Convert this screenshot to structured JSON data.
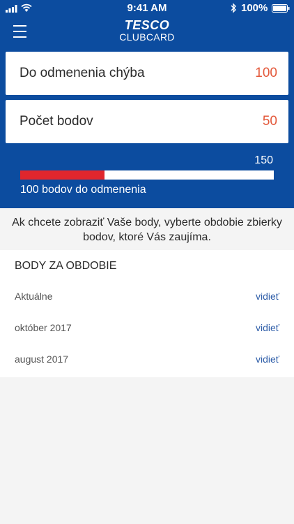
{
  "status": {
    "time": "9:41 AM",
    "battery": "100%"
  },
  "brand": {
    "line1": "TESCO",
    "line2": "CLUBCARD"
  },
  "cards": [
    {
      "label": "Do odmenenia chýba",
      "value": "100"
    },
    {
      "label": "Počet bodov",
      "value": "50"
    }
  ],
  "progress": {
    "max_label": "150",
    "fraction": 0.333,
    "caption": "100 bodov do odmenenia"
  },
  "info": "Ak chcete zobraziť Vaše body, vyberte obdobie zbierky bodov, ktoré Vás zaujíma.",
  "periods": {
    "header": "BODY ZA OBDOBIE",
    "items": [
      {
        "name": "Aktuálne",
        "link": "vidieť"
      },
      {
        "name": "október 2017",
        "link": "vidieť"
      },
      {
        "name": "august 2017",
        "link": "vidieť"
      }
    ]
  },
  "colors": {
    "header_bg": "#0c4c9f",
    "accent_value": "#e3583a",
    "bar_fill": "#e0262d",
    "link": "#2e5da8"
  },
  "icons": [
    "signal-icon",
    "wifi-icon",
    "bluetooth-icon",
    "battery-icon",
    "menu-icon"
  ]
}
